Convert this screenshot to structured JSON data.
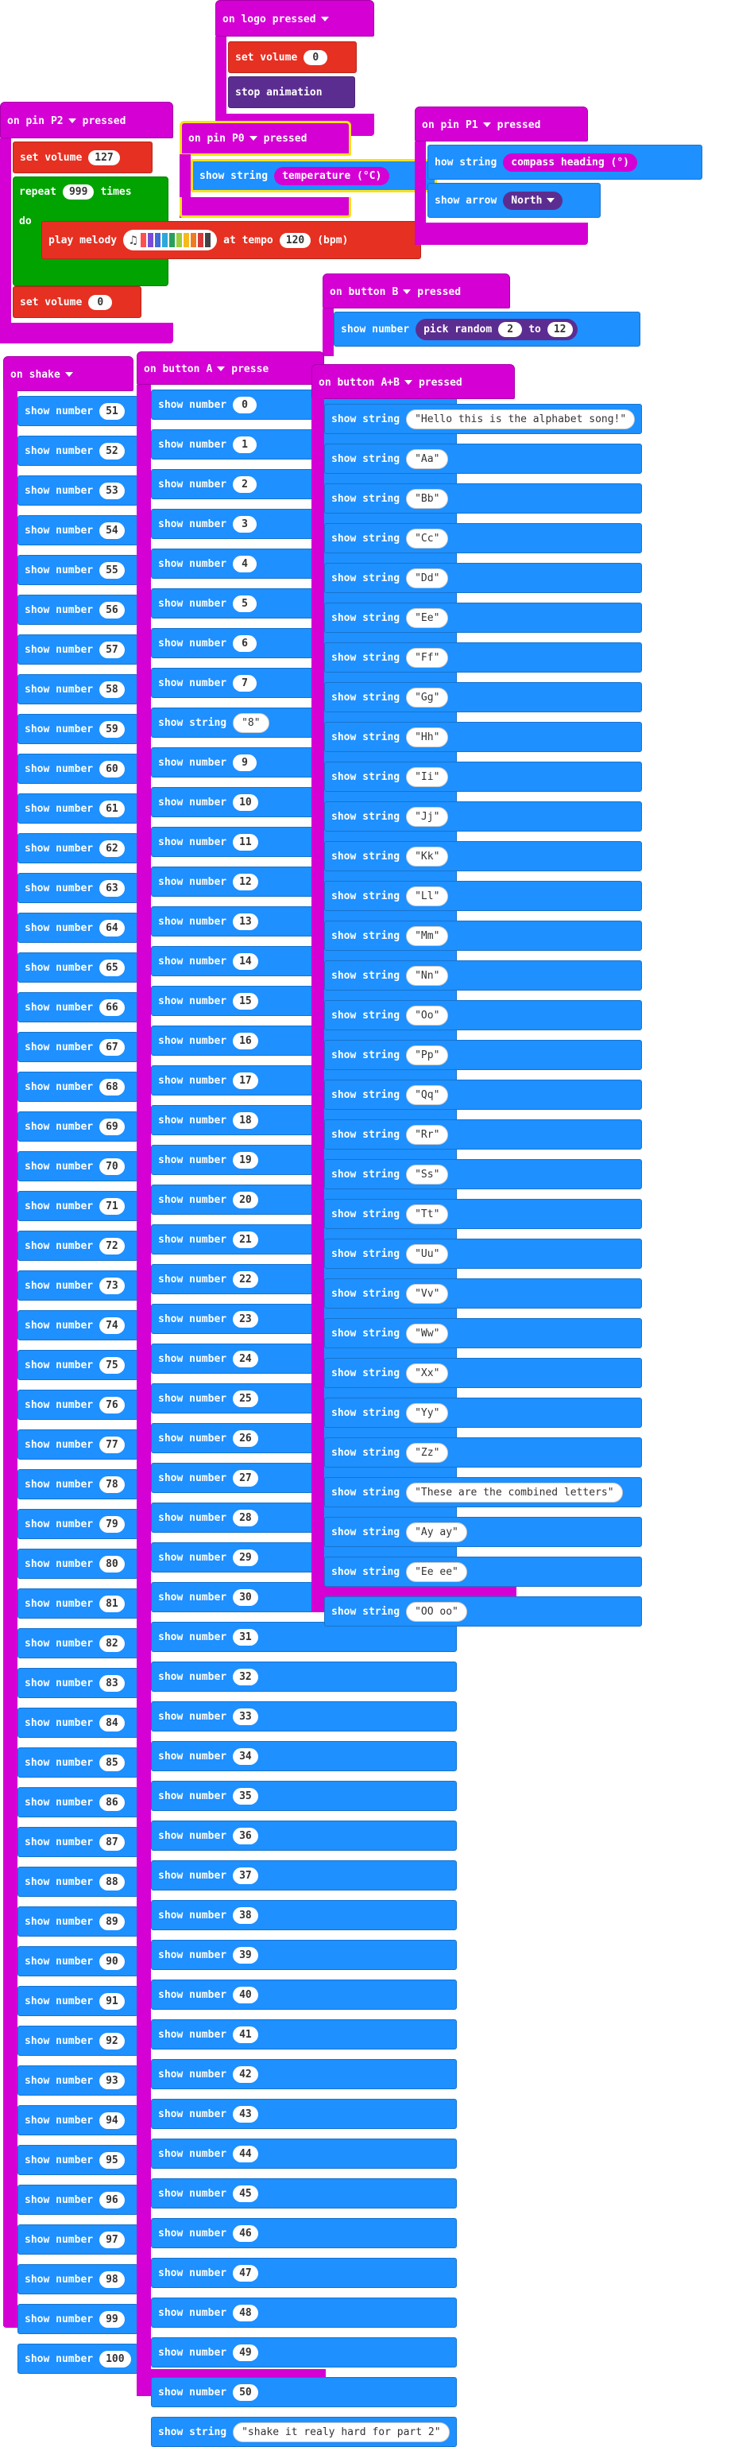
{
  "logo_event": {
    "title": "on logo",
    "state": "pressed",
    "set_volume": "set volume",
    "volume": "0",
    "stop": "stop animation"
  },
  "pin_p2": {
    "title": "on pin",
    "pin": "P2",
    "state": "pressed",
    "set_volume": "set volume",
    "vol1": "127",
    "repeat": "repeat",
    "times_val": "999",
    "times": "times",
    "do": "do",
    "play": "play melody",
    "at_tempo": "at tempo",
    "tempo": "120",
    "bpm": "(bpm)",
    "vol2": "0"
  },
  "pin_p0": {
    "title": "on pin",
    "pin": "P0",
    "state": "pressed",
    "show_string": "show string",
    "reporter": "temperature (°C)"
  },
  "pin_p1": {
    "title": "on pin",
    "pin": "P1",
    "state": "pressed",
    "show_string": "how string",
    "reporter": "compass heading (°)",
    "show_arrow": "show arrow",
    "arrow": "North"
  },
  "button_b": {
    "title": "on button",
    "button": "B",
    "state": "pressed",
    "show_number": "show number",
    "pick": "pick random",
    "from": "2",
    "to": "to",
    "to_val": "12"
  },
  "shake": {
    "title": "on",
    "gesture": "shake",
    "label": "show number",
    "numbers": [
      "51",
      "52",
      "53",
      "54",
      "55",
      "56",
      "57",
      "58",
      "59",
      "60",
      "61",
      "62",
      "63",
      "64",
      "65",
      "66",
      "67",
      "68",
      "69",
      "70",
      "71",
      "72",
      "73",
      "74",
      "75",
      "76",
      "77",
      "78",
      "79",
      "80",
      "81",
      "82",
      "83",
      "84",
      "85",
      "86",
      "87",
      "88",
      "89",
      "90",
      "91",
      "92",
      "93",
      "94",
      "95",
      "96",
      "97",
      "98",
      "99",
      "100"
    ]
  },
  "button_a": {
    "title": "on button",
    "button": "A",
    "state": "presse",
    "items": [
      {
        "label": "show number",
        "value": "0"
      },
      {
        "label": "show number",
        "value": "1"
      },
      {
        "label": "show number",
        "value": "2"
      },
      {
        "label": "show number",
        "value": "3"
      },
      {
        "label": "show number",
        "value": "4"
      },
      {
        "label": "show number",
        "value": "5"
      },
      {
        "label": "show number",
        "value": "6"
      },
      {
        "label": "show number",
        "value": "7"
      },
      {
        "label": "show string",
        "value": "\"8\""
      },
      {
        "label": "show number",
        "value": "9"
      },
      {
        "label": "show number",
        "value": "10"
      },
      {
        "label": "show number",
        "value": "11"
      },
      {
        "label": "show number",
        "value": "12"
      },
      {
        "label": "show number",
        "value": "13"
      },
      {
        "label": "show number",
        "value": "14"
      },
      {
        "label": "show number",
        "value": "15"
      },
      {
        "label": "show number",
        "value": "16"
      },
      {
        "label": "show number",
        "value": "17"
      },
      {
        "label": "show number",
        "value": "18"
      },
      {
        "label": "show number",
        "value": "19"
      },
      {
        "label": "show number",
        "value": "20"
      },
      {
        "label": "show number",
        "value": "21"
      },
      {
        "label": "show number",
        "value": "22"
      },
      {
        "label": "show number",
        "value": "23"
      },
      {
        "label": "show number",
        "value": "24"
      },
      {
        "label": "show number",
        "value": "25"
      },
      {
        "label": "show number",
        "value": "26"
      },
      {
        "label": "show number",
        "value": "27"
      },
      {
        "label": "show number",
        "value": "28"
      },
      {
        "label": "show number",
        "value": "29"
      },
      {
        "label": "show number",
        "value": "30"
      },
      {
        "label": "show number",
        "value": "31"
      },
      {
        "label": "show number",
        "value": "32"
      },
      {
        "label": "show number",
        "value": "33"
      },
      {
        "label": "show number",
        "value": "34"
      },
      {
        "label": "show number",
        "value": "35"
      },
      {
        "label": "show number",
        "value": "36"
      },
      {
        "label": "show number",
        "value": "37"
      },
      {
        "label": "show number",
        "value": "38"
      },
      {
        "label": "show number",
        "value": "39"
      },
      {
        "label": "show number",
        "value": "40"
      },
      {
        "label": "show number",
        "value": "41"
      },
      {
        "label": "show number",
        "value": "42"
      },
      {
        "label": "show number",
        "value": "43"
      },
      {
        "label": "show number",
        "value": "44"
      },
      {
        "label": "show number",
        "value": "45"
      },
      {
        "label": "show number",
        "value": "46"
      },
      {
        "label": "show number",
        "value": "47"
      },
      {
        "label": "show number",
        "value": "48"
      },
      {
        "label": "show number",
        "value": "49"
      },
      {
        "label": "show number",
        "value": "50"
      },
      {
        "label": "show string",
        "value": "\"shake it realy hard for part 2\""
      }
    ]
  },
  "button_ab": {
    "title": "on button",
    "button": "A+B",
    "state": "pressed",
    "label": "show string",
    "strings": [
      "\"Hello this is the alphabet song!\"",
      "\"Aa\"",
      "\"Bb\"",
      "\"Cc\"",
      "\"Dd\"",
      "\"Ee\"",
      "\"Ff\"",
      "\"Gg\"",
      "\"Hh\"",
      "\"Ii\"",
      "\"Jj\"",
      "\"Kk\"",
      "\"Ll\"",
      "\"Mm\"",
      "\"Nn\"",
      "\"Oo\"",
      "\"Pp\"",
      "\"Qq\"",
      "\"Rr\"",
      "\"Ss\"",
      "\"Tt\"",
      "\"Uu\"",
      "\"Vv\"",
      "\"Ww\"",
      "\"Xx\"",
      "\"Yy\"",
      "\"Zz\"",
      "\"These are the combined letters\"",
      "\"Ay ay\"",
      "\"Ee ee\"",
      "\"OO oo\""
    ]
  },
  "melody_colors": [
    "#ff4e4e",
    "#7a4bd9",
    "#3f6cd6",
    "#2da8d8",
    "#28a05a",
    "#9ccd3b",
    "#f6b91e",
    "#f07a22",
    "#d83a3a",
    "#444444"
  ]
}
